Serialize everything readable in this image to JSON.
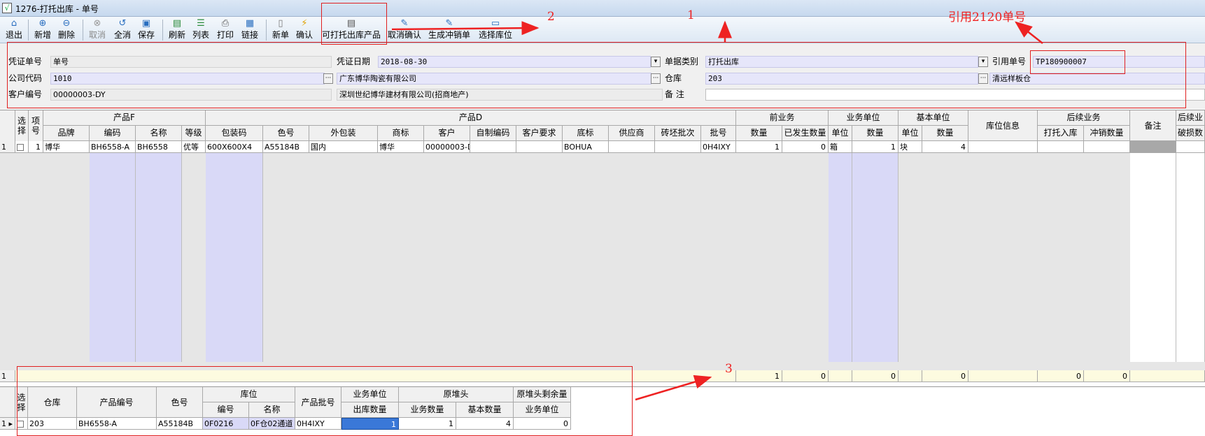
{
  "window": {
    "title": "1276-打托出库 - 单号"
  },
  "toolbar": {
    "items": [
      {
        "label": "退出",
        "icon": "home-icon"
      },
      {
        "label": "新增",
        "icon": "add-icon"
      },
      {
        "label": "删除",
        "icon": "remove-icon"
      },
      {
        "label": "取消",
        "icon": "cancel-icon"
      },
      {
        "label": "全消",
        "icon": "undo-icon"
      },
      {
        "label": "保存",
        "icon": "save-icon"
      },
      {
        "label": "刷新",
        "icon": "refresh-icon"
      },
      {
        "label": "列表",
        "icon": "list-icon"
      },
      {
        "label": "打印",
        "icon": "print-icon"
      },
      {
        "label": "链接",
        "icon": "link-icon"
      },
      {
        "label": "新单",
        "icon": "new-doc-icon"
      },
      {
        "label": "确认",
        "icon": "confirm-icon"
      },
      {
        "label": "可打托出库产品",
        "icon": "product-icon"
      },
      {
        "label": "取消确认",
        "icon": "cancel-confirm-icon"
      },
      {
        "label": "生成冲销单",
        "icon": "generate-icon"
      },
      {
        "label": "选择库位",
        "icon": "location-icon"
      }
    ]
  },
  "header": {
    "voucher_no_label": "凭证单号",
    "voucher_no": "单号",
    "voucher_date_label": "凭证日期",
    "voucher_date": "2018-08-30",
    "doc_type_label": "单据类别",
    "doc_type": "打托出库",
    "ref_no_label": "引用单号",
    "ref_no": "TP180900007",
    "company_label": "公司代码",
    "company_code": "1010",
    "company_name": "广东博华陶瓷有限公司",
    "warehouse_label": "仓库",
    "warehouse_code": "203",
    "warehouse_name": "清远样板仓",
    "customer_label": "客户编号",
    "customer_code": "00000003-DY",
    "customer_name": "深圳世纪博华建材有限公司(招商地产)",
    "remark_label": "备    注",
    "remark": ""
  },
  "grid": {
    "group_headers": [
      "选择",
      "项号",
      "产品F",
      "产品D",
      "前业务",
      "业务单位",
      "基本单位",
      "库位信息",
      "后续业务",
      "备注",
      "后续业"
    ],
    "columns": [
      "品牌",
      "编码",
      "名称",
      "等级",
      "包装码",
      "色号",
      "外包装",
      "商标",
      "客户",
      "自制编码",
      "客户要求",
      "底标",
      "供应商",
      "砖坯批次",
      "批号",
      "数量",
      "已发生数量",
      "单位",
      "数量",
      "单位",
      "数量",
      "打托入库",
      "冲销数量",
      "破损数"
    ],
    "row": {
      "row_no": "1",
      "item_no": "1",
      "brand": "博华",
      "code": "BH6558-A",
      "name": "BH6558",
      "grade": "优等",
      "pack_code": "600X600X4",
      "color_no": "A55184B",
      "outer_pack": "国内",
      "trademark": "博华",
      "customer": "00000003-DY",
      "self_code": "",
      "cust_req": "",
      "bottom_mark": "BOHUA",
      "supplier": "",
      "brick_batch": "",
      "batch_no": "0H4IXY",
      "prev_qty": "1",
      "occurred_qty": "0",
      "biz_unit": "箱",
      "biz_qty": "1",
      "base_unit": "块",
      "base_qty": "4"
    },
    "footer": {
      "row_no": "1",
      "prev_qty": "1",
      "occurred_qty": "0",
      "biz_qty": "0",
      "base_qty": "0",
      "pallet_in": "0",
      "offset_qty": "0"
    }
  },
  "subgrid": {
    "headers": {
      "select": "选择",
      "warehouse": "仓库",
      "product_code": "产品编号",
      "color_no": "色号",
      "location": "库位",
      "loc_code": "编号",
      "loc_name": "名称",
      "batch_no": "产品批号",
      "biz_unit": "业务单位",
      "out_qty": "出库数量",
      "orig_head": "原堆头",
      "biz_qty": "业务数量",
      "base_qty": "基本数量",
      "remain": "原堆头剩余量",
      "remain_unit": "业务单位"
    },
    "row": {
      "warehouse": "203",
      "product_code": "BH6558-A",
      "color_no": "A55184B",
      "loc_code": "0F0216",
      "loc_name": "0F仓02通道",
      "batch_no": "0H4IXY",
      "out_qty": "1",
      "biz_qty": "1",
      "base_qty": "4",
      "remain": "0"
    }
  },
  "annotations": {
    "a1": "1",
    "a2": "2",
    "a3": "3",
    "note": "引用2120单号"
  },
  "colors": {
    "lavender": "#e6e6fa",
    "accent_red": "#e02020"
  }
}
